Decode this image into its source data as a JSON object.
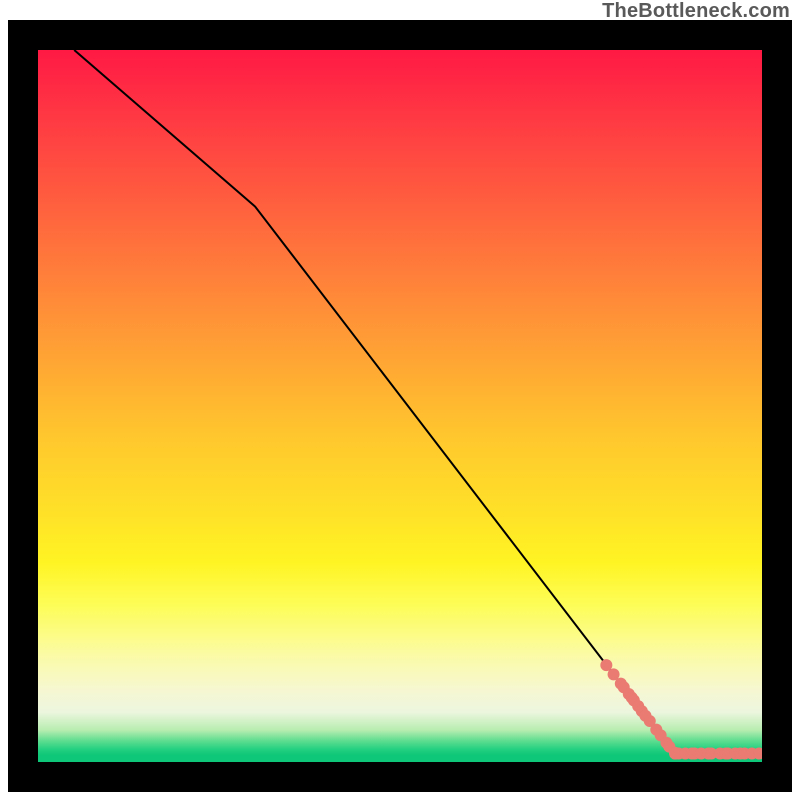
{
  "attribution": "TheBottleneck.com",
  "colors": {
    "marker": "#e97b72",
    "line": "#000000"
  },
  "chart_data": {
    "type": "line",
    "title": "",
    "xlabel": "",
    "ylabel": "",
    "xlim": [
      0,
      100
    ],
    "ylim": [
      0,
      100
    ],
    "grid": false,
    "legend": false,
    "series": [
      {
        "name": "curve",
        "kind": "line",
        "x": [
          5,
          30,
          82,
          88,
          100
        ],
        "y": [
          100,
          78,
          9,
          1.2,
          1.2
        ]
      },
      {
        "name": "points-on-line-upper",
        "kind": "scatter",
        "x": [
          78.5,
          79.5,
          80.5,
          80.9,
          81.6,
          82.0,
          82.3,
          82.9,
          83.4,
          83.9,
          84.5,
          85.4,
          86.0,
          86.8,
          87.2,
          88.0,
          88.0
        ],
        "y": [
          13.6,
          12.3,
          11.0,
          10.5,
          9.55,
          9.05,
          8.65,
          7.85,
          7.15,
          6.5,
          5.75,
          4.55,
          3.75,
          2.7,
          2.15,
          1.3,
          1.2
        ]
      },
      {
        "name": "points-bottom-flat",
        "kind": "scatter",
        "x": [
          88.0,
          88.5,
          89.4,
          90.3,
          90.7,
          91.6,
          92.6,
          93.0,
          94.2,
          95.0,
          95.3,
          96.3,
          97.0,
          97.6,
          98.6,
          99.6
        ],
        "y": [
          1.2,
          1.2,
          1.2,
          1.2,
          1.2,
          1.2,
          1.2,
          1.2,
          1.2,
          1.2,
          1.2,
          1.2,
          1.2,
          1.2,
          1.2,
          1.2
        ]
      }
    ]
  }
}
